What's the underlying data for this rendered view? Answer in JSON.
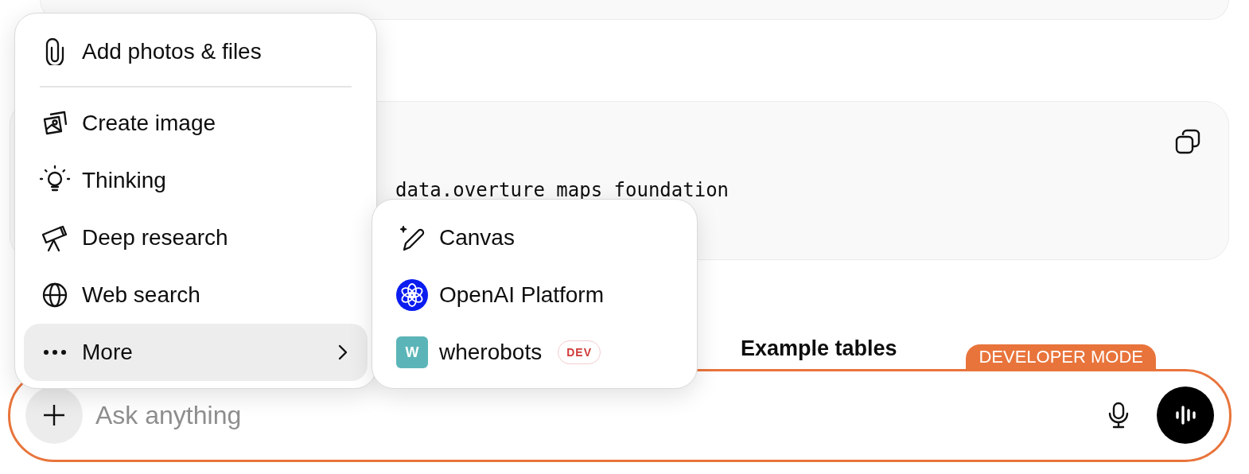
{
  "background": {
    "code_line": "data.overture maps foundation",
    "heading": "Example tables"
  },
  "menu": {
    "items": [
      {
        "kind": "attach",
        "label": "Add photos & files",
        "selected": false
      },
      {
        "kind": "divider"
      },
      {
        "kind": "image",
        "label": "Create image",
        "selected": false
      },
      {
        "kind": "thinking",
        "label": "Thinking",
        "selected": false
      },
      {
        "kind": "research",
        "label": "Deep research",
        "selected": false
      },
      {
        "kind": "web",
        "label": "Web search",
        "selected": false
      },
      {
        "kind": "more",
        "label": "More",
        "selected": true
      }
    ]
  },
  "submenu": {
    "items": [
      {
        "kind": "canvas",
        "label": "Canvas"
      },
      {
        "kind": "platform",
        "label": "OpenAI Platform"
      },
      {
        "kind": "connector",
        "label": "wherobots",
        "initial": "W",
        "badge": "DEV"
      }
    ]
  },
  "composer": {
    "placeholder": "Ask anything",
    "mode_badge": "DEVELOPER MODE"
  }
}
